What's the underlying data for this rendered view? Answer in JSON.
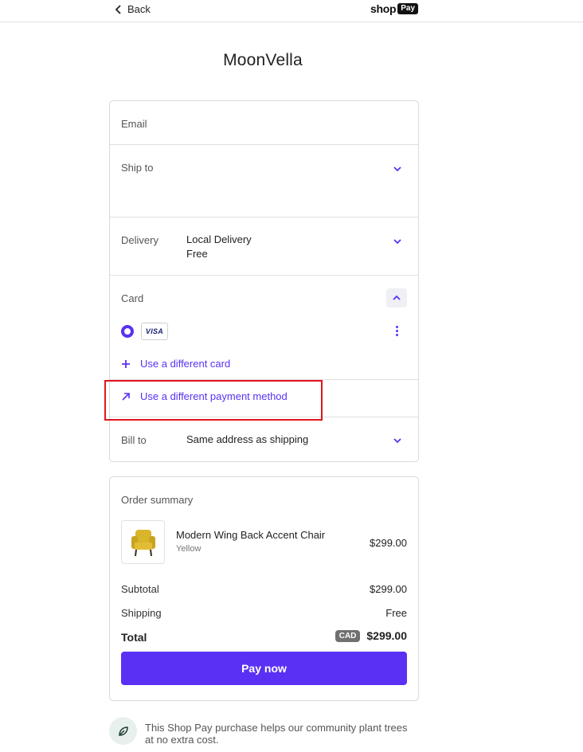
{
  "header": {
    "back_label": "Back",
    "logo_shop": "shop",
    "logo_pay": "Pay"
  },
  "store": {
    "name": "MoonVella"
  },
  "checkout": {
    "email_label": "Email",
    "ship_to_label": "Ship to",
    "delivery_label": "Delivery",
    "delivery_method": "Local Delivery",
    "delivery_cost": "Free",
    "card_label": "Card",
    "card_brand": "VISA",
    "use_different_card": "Use a different card",
    "use_different_method": "Use a different payment method",
    "bill_to_label": "Bill to",
    "bill_to_value": "Same address as shipping"
  },
  "summary": {
    "title": "Order summary",
    "product_name": "Modern Wing Back Accent Chair",
    "product_variant": "Yellow",
    "product_price": "$299.00",
    "subtotal_label": "Subtotal",
    "subtotal_value": "$299.00",
    "shipping_label": "Shipping",
    "shipping_value": "Free",
    "total_label": "Total",
    "currency": "CAD",
    "total_value": "$299.00",
    "pay_button": "Pay now"
  },
  "footer": {
    "tree_message": "This Shop Pay purchase helps our community plant trees at no extra cost."
  },
  "colors": {
    "accent": "#5a31f4",
    "highlight": "#e0141e"
  }
}
